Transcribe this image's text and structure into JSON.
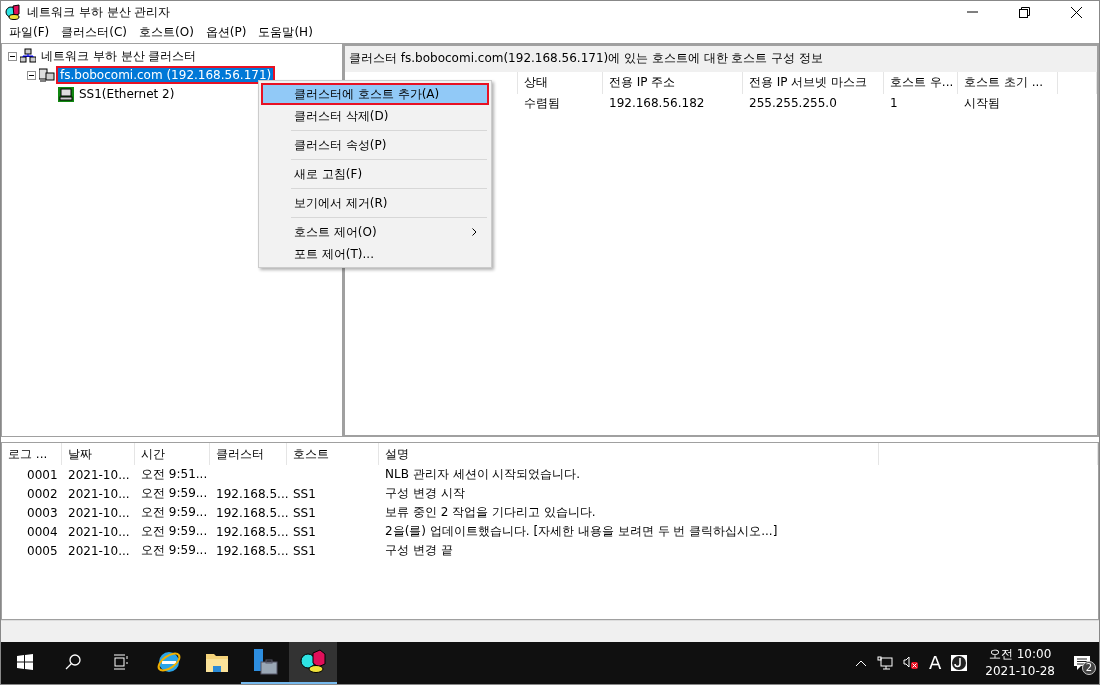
{
  "window": {
    "title": "네트워크 부하 분산 관리자"
  },
  "menu_bar": [
    "파일(F)",
    "클러스터(C)",
    "호스트(O)",
    "옵션(P)",
    "도움말(H)"
  ],
  "tree": {
    "label": "네트워크 부하 분산 클러스터",
    "expanded": true,
    "children": [
      {
        "label": "fs.bobocomi.com (192.168.56.171)",
        "selected": true,
        "expanded": true,
        "children": [
          {
            "label": "SS1(Ethernet 2)",
            "selected": false
          }
        ]
      }
    ]
  },
  "detail": {
    "title": "클러스터 fs.bobocomi.com(192.168.56.171)에 있는 호스트에 대한 호스트 구성 정보",
    "columns": [
      "상태",
      "전용 IP 주소",
      "전용 IP 서브넷 마스크",
      "호스트 우...",
      "호스트 초기 ..."
    ],
    "rows": [
      [
        "수렴됨",
        "192.168.56.182",
        "255.255.255.0",
        "1",
        "시작됨"
      ]
    ]
  },
  "context_menu": {
    "groups": [
      [
        {
          "label": "클러스터에 호스트 추가(A)",
          "selected": true,
          "submenu": false
        },
        {
          "label": "클러스터 삭제(D)",
          "selected": false,
          "submenu": false
        }
      ],
      [
        {
          "label": "클러스터 속성(P)",
          "selected": false,
          "submenu": false
        }
      ],
      [
        {
          "label": "새로 고침(F)",
          "selected": false,
          "submenu": false
        }
      ],
      [
        {
          "label": "보기에서 제거(R)",
          "selected": false,
          "submenu": false
        }
      ],
      [
        {
          "label": "호스트 제어(O)",
          "selected": false,
          "submenu": true
        },
        {
          "label": "포트 제어(T)...",
          "selected": false,
          "submenu": false
        }
      ]
    ]
  },
  "log": {
    "columns": [
      "로그 ...",
      "날짜",
      "시간",
      "클러스터",
      "호스트",
      "설명"
    ],
    "rows": [
      [
        "0001",
        "2021-10...",
        "오전 9:51...",
        "",
        "",
        "NLB 관리자 세션이 시작되었습니다."
      ],
      [
        "0002",
        "2021-10...",
        "오전 9:59...",
        "192.168.5...",
        "SS1",
        "구성 변경 시작"
      ],
      [
        "0003",
        "2021-10...",
        "오전 9:59...",
        "192.168.5...",
        "SS1",
        "보류 중인 2 작업을 기다리고 있습니다."
      ],
      [
        "0004",
        "2021-10...",
        "오전 9:59...",
        "192.168.5...",
        "SS1",
        "2을(를) 업데이트했습니다. [자세한 내용을 보려면 두 번 클릭하십시오...]"
      ],
      [
        "0005",
        "2021-10...",
        "오전 9:59...",
        "192.168.5...",
        "SS1",
        "구성 변경 끝"
      ]
    ]
  },
  "taskbar": {
    "apps": [
      {
        "kind": "browser",
        "running": false,
        "selected": false
      },
      {
        "kind": "folder",
        "running": false,
        "selected": false
      },
      {
        "kind": "server",
        "running": true,
        "selected": false
      },
      {
        "kind": "nlb",
        "running": true,
        "selected": true
      }
    ],
    "input_indicator": "A",
    "time": "오전 10:00",
    "date": "2021-10-28",
    "notification_count": "2"
  }
}
